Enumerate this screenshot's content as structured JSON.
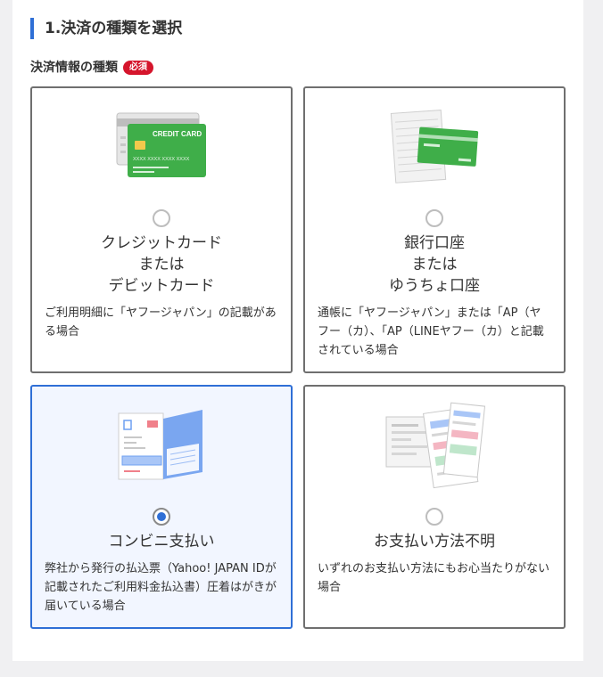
{
  "section": {
    "title": "1.決済の種類を選択"
  },
  "field": {
    "label": "決済情報の種類",
    "required_badge": "必須"
  },
  "options": [
    {
      "title_lines": [
        "クレジットカード",
        "または",
        "デビットカード"
      ],
      "description": "ご利用明細に「ヤフージャパン」の記載がある場合",
      "illustration": "credit-card-icon",
      "card_text": "CREDIT CARD",
      "card_number": "XXXX XXXX XXXX XXXX",
      "selected": false
    },
    {
      "title_lines": [
        "銀行口座",
        "または",
        "ゆうちょ口座"
      ],
      "description": "通帳に「ヤフージャパン」または「AP（ヤフー（カ）、「AP（LINEヤフー（カ）と記載されている場合",
      "illustration": "bank-passbook-icon",
      "selected": false
    },
    {
      "title_lines": [
        "コンビニ支払い"
      ],
      "description": "弊社から発行の払込票（Yahoo! JAPAN IDが記載されたご利用料金払込書）圧着はがきが届いている場合",
      "illustration": "convenience-store-slip-icon",
      "selected": true
    },
    {
      "title_lines": [
        "お支払い方法不明"
      ],
      "description": "いずれのお支払い方法にもお心当たりがない場合",
      "illustration": "payment-forms-icon",
      "selected": false
    }
  ],
  "colors": {
    "accent": "#2f6fd6",
    "badge": "#d5152c",
    "card_green": "#3fae49"
  }
}
